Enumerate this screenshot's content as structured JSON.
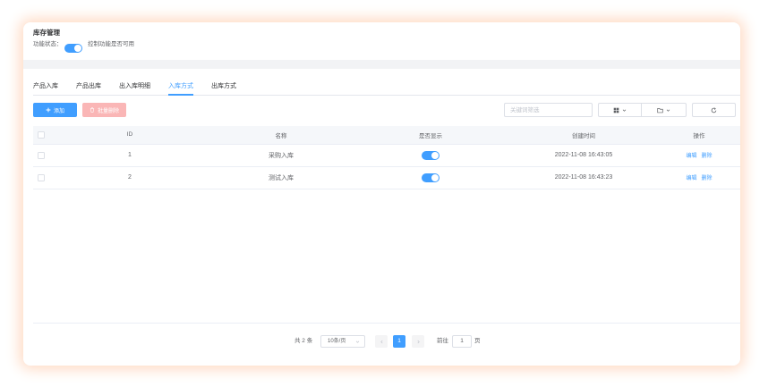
{
  "header": {
    "title": "库存管理",
    "status_label": "功能状态：",
    "status_enabled": true,
    "status_hint": "控制功能是否可用"
  },
  "tabs": [
    {
      "label": "产品入库",
      "active": false
    },
    {
      "label": "产品出库",
      "active": false
    },
    {
      "label": "出入库明细",
      "active": false
    },
    {
      "label": "入库方式",
      "active": true
    },
    {
      "label": "出库方式",
      "active": false
    }
  ],
  "toolbar": {
    "add_label": "添加",
    "add_icon": "plus-icon",
    "batch_delete_label": "批量删除",
    "batch_delete_icon": "trash-icon",
    "batch_delete_disabled": true,
    "search_placeholder": "关键词筛选",
    "search_value": "",
    "view_icon": "grid-icon",
    "export_icon": "folder-icon",
    "refresh_icon": "refresh-icon"
  },
  "table": {
    "columns": [
      "ID",
      "名称",
      "是否显示",
      "创建时间",
      "操作"
    ],
    "rows": [
      {
        "id": "1",
        "name": "采购入库",
        "visible": true,
        "created": "2022-11-08 16:43:05",
        "actions": [
          "编辑",
          "删除"
        ]
      },
      {
        "id": "2",
        "name": "测试入库",
        "visible": true,
        "created": "2022-11-08 16:43:23",
        "actions": [
          "编辑",
          "删除"
        ]
      }
    ]
  },
  "pagination": {
    "total_text": "共 2 条",
    "page_size": "10条/页",
    "current_page": "1",
    "goto_label": "前往",
    "goto_value": "1",
    "page_unit": "页"
  },
  "colors": {
    "primary": "#409eff",
    "danger_light": "#fab6b6",
    "text": "#303133",
    "text_secondary": "#606266",
    "placeholder": "#c0c4cc",
    "border": "#dcdfe6",
    "divider": "#ebeef5",
    "header_bg": "#f5f7fa",
    "page_bg": "#f2f3f5",
    "glow": "#ffd9c2"
  }
}
